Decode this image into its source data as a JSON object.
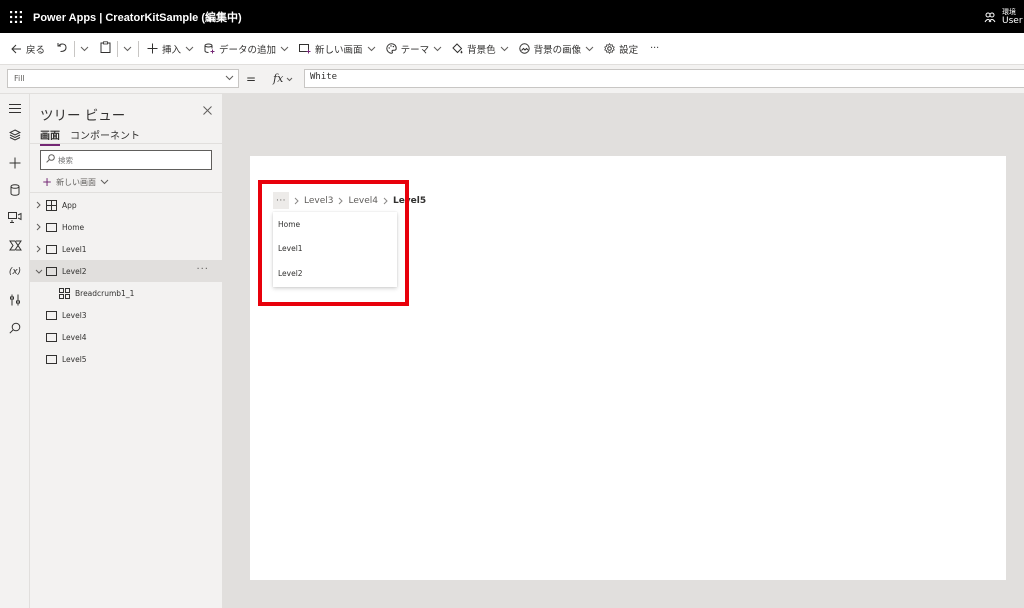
{
  "header": {
    "app_title": "Power Apps  |  CreatorKitSample (編集中)",
    "env_label": "環境",
    "user_label": "User"
  },
  "commandbar": {
    "back": "戻る",
    "insert": "挿入",
    "add_data": "データの追加",
    "new_screen": "新しい画面",
    "theme": "テーマ",
    "background_color": "背景色",
    "background_image": "背景の画像",
    "settings": "設定",
    "more": "···"
  },
  "formula": {
    "property": "Fill",
    "fx_label": "fx",
    "value": "White"
  },
  "tree": {
    "title": "ツリー ビュー",
    "tab_screens": "画面",
    "tab_components": "コンポーネント",
    "search_placeholder": "検索",
    "new_screen": "新しい画面",
    "nodes": [
      {
        "label": "App"
      },
      {
        "label": "Home"
      },
      {
        "label": "Level1"
      },
      {
        "label": "Level2"
      },
      {
        "label": "Breadcrumb1_1"
      },
      {
        "label": "Level3"
      },
      {
        "label": "Level4"
      },
      {
        "label": "Level5"
      }
    ],
    "more": "···"
  },
  "breadcrumb": {
    "overflow": "···",
    "items": [
      "Level3",
      "Level4",
      "Level5"
    ],
    "menu_items": [
      "Home",
      "Level1",
      "Level2"
    ]
  },
  "colors": {
    "accent": "#742774",
    "highlight": "#e8000b",
    "header_bg": "#000000"
  }
}
